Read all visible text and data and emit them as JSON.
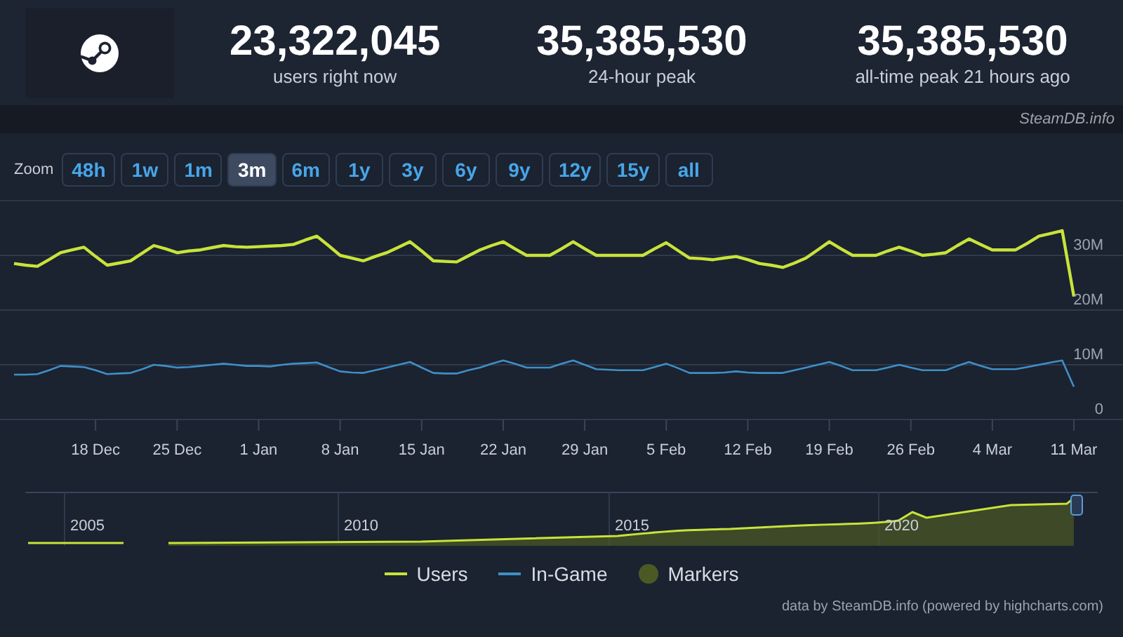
{
  "header": {
    "stats": [
      {
        "value": "23,322,045",
        "label": "users right now"
      },
      {
        "value": "35,385,530",
        "label": "24-hour peak"
      },
      {
        "value": "35,385,530",
        "label": "all-time peak 21 hours ago"
      }
    ],
    "credit": "SteamDB.info"
  },
  "zoom": {
    "label": "Zoom",
    "buttons": [
      {
        "label": "48h",
        "selected": false
      },
      {
        "label": "1w",
        "selected": false
      },
      {
        "label": "1m",
        "selected": false
      },
      {
        "label": "3m",
        "selected": true
      },
      {
        "label": "6m",
        "selected": false
      },
      {
        "label": "1y",
        "selected": false
      },
      {
        "label": "3y",
        "selected": false
      },
      {
        "label": "6y",
        "selected": false
      },
      {
        "label": "9y",
        "selected": false
      },
      {
        "label": "12y",
        "selected": false
      },
      {
        "label": "15y",
        "selected": false
      },
      {
        "label": "all",
        "selected": false
      }
    ]
  },
  "chart": {
    "chart_data": {
      "type": "line",
      "categories": [
        null,
        null,
        null,
        null,
        null,
        null,
        null,
        "18 Dec",
        null,
        null,
        null,
        null,
        null,
        null,
        "25 Dec",
        null,
        null,
        null,
        null,
        null,
        null,
        "1 Jan",
        null,
        null,
        null,
        null,
        null,
        null,
        "8 Jan",
        null,
        null,
        null,
        null,
        null,
        null,
        "15 Jan",
        null,
        null,
        null,
        null,
        null,
        null,
        "22 Jan",
        null,
        null,
        null,
        null,
        null,
        null,
        "29 Jan",
        null,
        null,
        null,
        null,
        null,
        null,
        "5 Feb",
        null,
        null,
        null,
        null,
        null,
        null,
        "12 Feb",
        null,
        null,
        null,
        null,
        null,
        null,
        "19 Feb",
        null,
        null,
        null,
        null,
        null,
        null,
        "26 Feb",
        null,
        null,
        null,
        null,
        null,
        null,
        "4 Mar",
        null,
        null,
        null,
        null,
        null,
        null,
        "11 Mar"
      ],
      "series": [
        {
          "name": "Users",
          "color": "#c8e33a",
          "values": [
            28.5,
            28.2,
            28,
            29.2,
            30.5,
            31,
            31.5,
            29.8,
            28.2,
            28.6,
            29,
            30.4,
            31.8,
            31.2,
            30.5,
            30.8,
            31,
            31.4,
            31.8,
            31.6,
            31.5,
            31.6,
            31.7,
            31.8,
            32,
            32.8,
            33.5,
            31.8,
            30,
            29.5,
            29,
            29.8,
            30.5,
            31.5,
            32.5,
            30.8,
            29,
            28.9,
            28.8,
            29.9,
            31,
            31.8,
            32.5,
            31.2,
            30,
            30,
            30,
            31.2,
            32.5,
            31.2,
            30,
            30,
            30,
            30,
            30,
            31.2,
            32.3,
            30.9,
            29.5,
            29.4,
            29.2,
            29.5,
            29.8,
            29.2,
            28.5,
            28.2,
            27.8,
            28.6,
            29.5,
            31,
            32.5,
            31.2,
            30,
            30,
            30,
            30.8,
            31.5,
            30.8,
            30,
            30.2,
            30.5,
            31.8,
            33,
            32,
            31,
            31,
            31,
            32.2,
            33.5,
            34,
            34.5,
            22.5
          ]
        },
        {
          "name": "In-Game",
          "color": "#3f8fc6",
          "values": [
            8.2,
            8.2,
            8.3,
            9,
            9.8,
            9.7,
            9.6,
            9,
            8.3,
            8.4,
            8.5,
            9.2,
            10,
            9.8,
            9.5,
            9.6,
            9.8,
            10,
            10.2,
            10,
            9.8,
            9.8,
            9.7,
            10,
            10.2,
            10.3,
            10.4,
            9.6,
            8.8,
            8.6,
            8.5,
            9,
            9.5,
            10,
            10.5,
            9.5,
            8.5,
            8.4,
            8.4,
            9,
            9.5,
            10.2,
            10.8,
            10.2,
            9.5,
            9.5,
            9.5,
            10.2,
            10.8,
            10,
            9.2,
            9.1,
            9,
            9,
            9,
            9.6,
            10.2,
            9.4,
            8.5,
            8.5,
            8.5,
            8.6,
            8.8,
            8.6,
            8.5,
            8.5,
            8.5,
            9,
            9.5,
            10,
            10.5,
            9.8,
            9,
            9,
            9,
            9.5,
            10,
            9.5,
            9,
            9,
            9,
            9.8,
            10.5,
            9.8,
            9.2,
            9.2,
            9.2,
            9.6,
            10,
            10.4,
            10.8,
            6
          ]
        }
      ],
      "ylim": [
        0,
        40
      ],
      "grid": true,
      "yticks": [
        {
          "value": 0,
          "label": "0"
        },
        {
          "value": 10,
          "label": "10M"
        },
        {
          "value": 20,
          "label": "20M"
        },
        {
          "value": 30,
          "label": "30M"
        }
      ]
    }
  },
  "navigator": {
    "year_labels": [
      "2005",
      "2010",
      "2015",
      "2020"
    ]
  },
  "markers_legend": {
    "label": "Markers",
    "color": "#4b5a24"
  },
  "footer": "data by SteamDB.info (powered by highcharts.com)"
}
